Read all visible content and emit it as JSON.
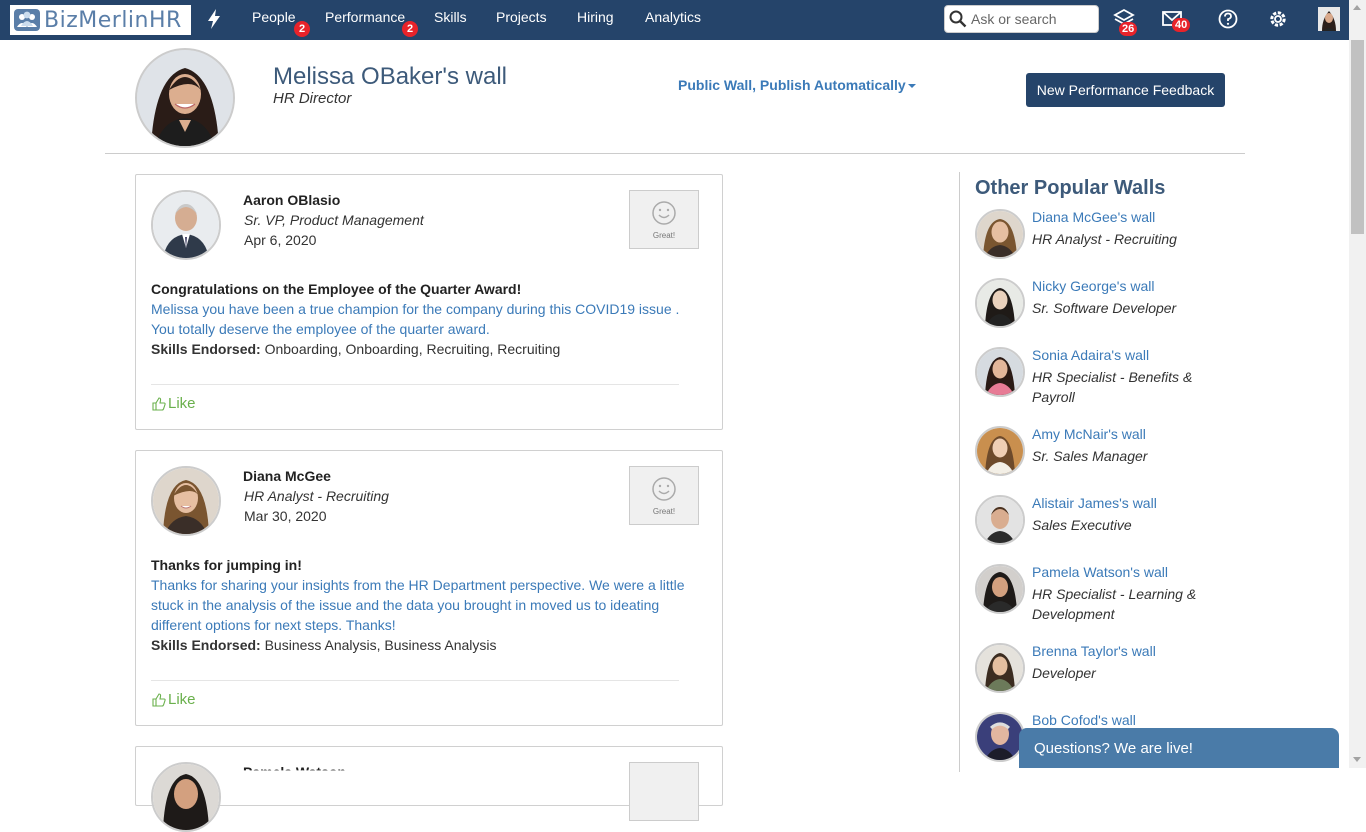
{
  "colors": {
    "navbar": "#25446a",
    "badge": "#e8232a",
    "link": "#3b7ab8",
    "like": "#6ab04c",
    "chat": "#4a7ba8"
  },
  "navbar": {
    "logo_text": "BizMerlinHR",
    "items": [
      {
        "label": "People",
        "badge": "2"
      },
      {
        "label": "Performance",
        "badge": "2"
      },
      {
        "label": "Skills"
      },
      {
        "label": "Projects"
      },
      {
        "label": "Hiring"
      },
      {
        "label": "Analytics"
      }
    ],
    "search_placeholder": "Ask or search",
    "icons": [
      {
        "name": "layers-icon",
        "badge": "26"
      },
      {
        "name": "mail-icon",
        "badge": "40"
      },
      {
        "name": "help-icon"
      },
      {
        "name": "gear-icon"
      },
      {
        "name": "user-avatar"
      }
    ]
  },
  "profile": {
    "name": "Melissa OBaker's wall",
    "role": "HR Director",
    "wall_setting": "Public Wall, Publish Automatically",
    "feedback_button": "New Performance Feedback"
  },
  "posts": [
    {
      "author": "Aaron OBlasio",
      "role": "Sr. VP, Product Management",
      "date": "Apr 6, 2020",
      "badge_label": "Great!",
      "heading": "Congratulations on the Employee of the Quarter Award!",
      "body": " Melissa you have been a true champion for the company during this COVID19 issue . You totally deserve the employee of the quarter award.",
      "skills_label": "Skills Endorsed:",
      "skills": "Onboarding, Onboarding, Recruiting, Recruiting",
      "like_label": "Like"
    },
    {
      "author": "Diana McGee",
      "role": "HR Analyst - Recruiting",
      "date": "Mar 30, 2020",
      "badge_label": "Great!",
      "heading": "Thanks for jumping in!",
      "body": " Thanks for sharing your insights from the HR Department perspective. We were a little stuck in the analysis of the issue and the data you brought in moved us to ideating different options for next steps. Thanks!",
      "skills_label": "Skills Endorsed:",
      "skills": "Business Analysis, Business Analysis",
      "like_label": "Like"
    },
    {
      "author": "Pamela Watson"
    }
  ],
  "sidebar": {
    "title": "Other Popular Walls",
    "walls": [
      {
        "link": "Diana McGee's wall",
        "role": "HR Analyst - Recruiting"
      },
      {
        "link": "Nicky George's wall",
        "role": "Sr. Software Developer"
      },
      {
        "link": "Sonia Adaira's wall",
        "role": "HR Specialist - Benefits & Payroll"
      },
      {
        "link": "Amy McNair's wall",
        "role": "Sr. Sales Manager"
      },
      {
        "link": "Alistair James's wall",
        "role": "Sales Executive"
      },
      {
        "link": "Pamela Watson's wall",
        "role": "HR Specialist - Learning & Development"
      },
      {
        "link": "Brenna Taylor's wall",
        "role": "Developer"
      },
      {
        "link": "Bob Cofod's wall",
        "role": ""
      }
    ]
  },
  "chat": {
    "label": "Questions? We are live!"
  }
}
